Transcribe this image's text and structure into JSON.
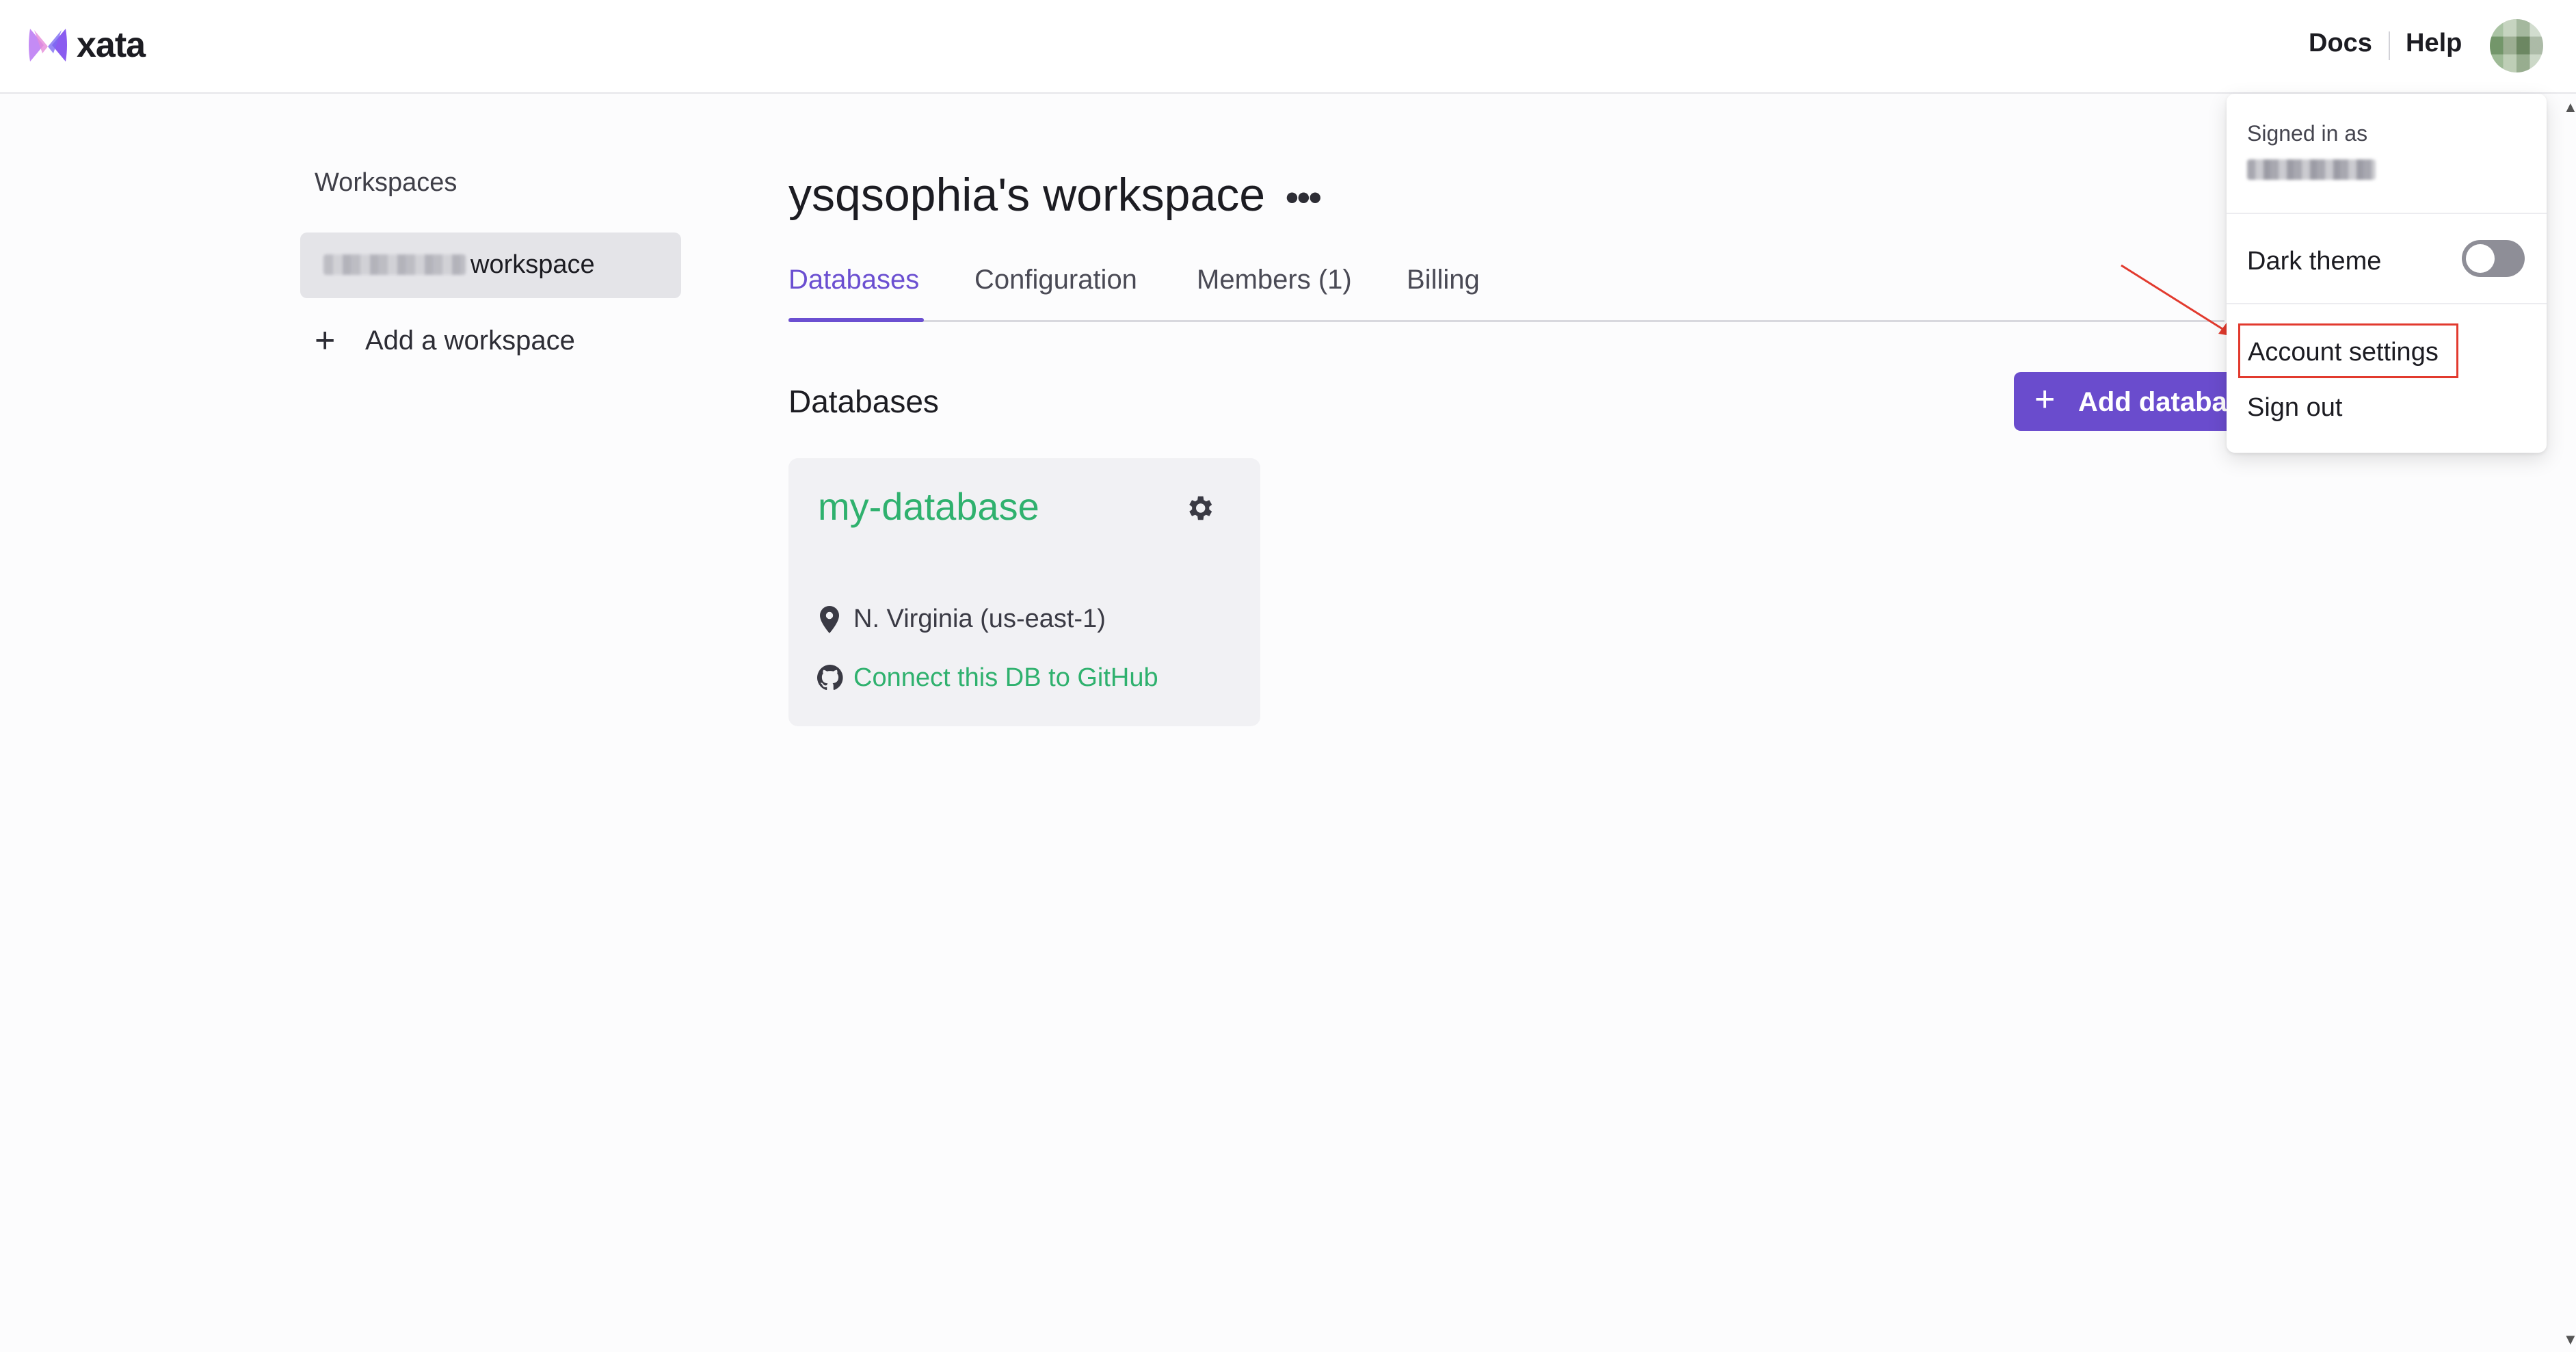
{
  "app": {
    "name": "xata",
    "brand_color": "#6a4ccd",
    "link_color": "#2fb16e"
  },
  "header": {
    "docs_label": "Docs",
    "help_label": "Help"
  },
  "sidebar": {
    "title": "Workspaces",
    "workspace_item_suffix": "workspace",
    "add_workspace_label": "Add a workspace"
  },
  "main": {
    "workspace_title": "ysqsophia's workspace",
    "more_label": "•••",
    "tabs": [
      {
        "label": "Databases",
        "active": true
      },
      {
        "label": "Configuration",
        "active": false
      },
      {
        "label": "Members (1)",
        "active": false
      },
      {
        "label": "Billing",
        "active": false
      }
    ],
    "section_title": "Databases",
    "add_database_label": "Add databas",
    "database_card": {
      "name": "my-database",
      "region": "N. Virginia (us-east-1)",
      "github_link": "Connect this DB to GitHub"
    }
  },
  "user_menu": {
    "signed_in_label": "Signed in as",
    "dark_theme_label": "Dark theme",
    "dark_theme_enabled": false,
    "account_settings_label": "Account settings",
    "sign_out_label": "Sign out",
    "highlight_color": "#e23a2e"
  }
}
